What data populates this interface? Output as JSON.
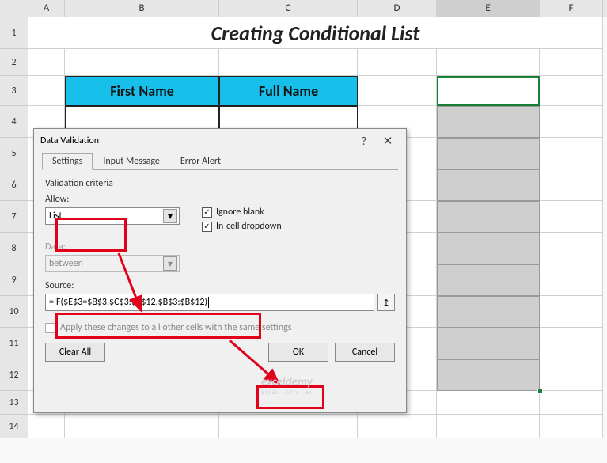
{
  "columns": [
    "A",
    "B",
    "C",
    "D",
    "E",
    "F"
  ],
  "rows": [
    "1",
    "2",
    "3",
    "4",
    "5",
    "6",
    "7",
    "8",
    "9",
    "10",
    "11",
    "12",
    "13",
    "14"
  ],
  "title": "Creating Conditional List",
  "table_headers": {
    "b": "First Name",
    "c": "Full Name"
  },
  "dialog": {
    "title": "Data Validation",
    "help": "?",
    "close": "✕",
    "tabs": {
      "settings": "Settings",
      "input": "Input Message",
      "error": "Error Alert"
    },
    "criteria_label": "Validation criteria",
    "allow_label": "Allow:",
    "allow_value": "List",
    "ignore_blank": "Ignore blank",
    "in_cell": "In-cell dropdown",
    "data_label": "Data:",
    "data_value": "between",
    "source_label": "Source:",
    "source_value": "=IF($E$3=$B$3,$C$3:$C$12,$B$3:$B$12)",
    "apply_label": "Apply these changes to all other cells with the same settings",
    "clear": "Clear All",
    "ok": "OK",
    "cancel": "Cancel"
  },
  "watermark": {
    "brand": "exceldemy",
    "tag": "EXCEL · DATA · BI"
  },
  "chevron": "▾",
  "check": "✓",
  "upArrow": "↥"
}
